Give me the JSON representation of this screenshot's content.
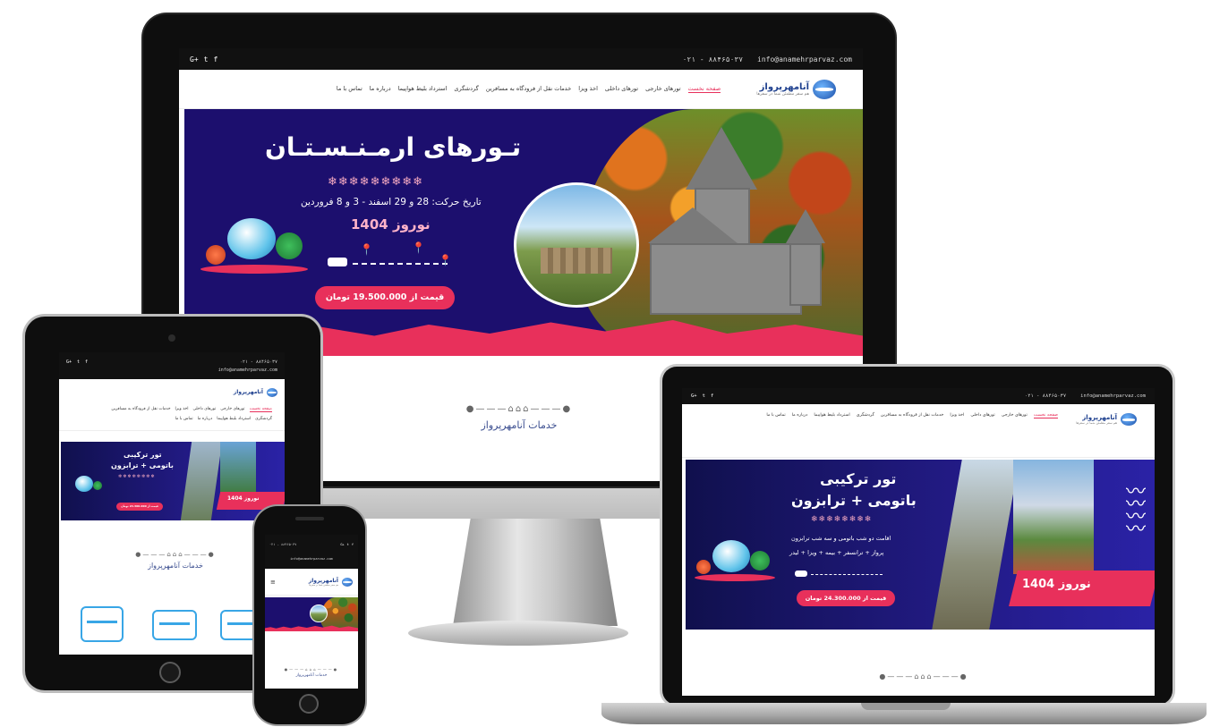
{
  "site": {
    "logo_text": "آنامهرپرواز",
    "logo_sub": "هم سفر مطمئن شما در سفرها",
    "social_icons": [
      "google-plus-icon",
      "twitter-icon",
      "facebook-icon"
    ],
    "phone": "۰۲۱ - ۸۸۴۶۵۰۳۷",
    "email": "info@anamehrparvaz.com"
  },
  "nav": {
    "items": [
      {
        "label": "صفحه نخست",
        "active": true
      },
      {
        "label": "تورهای خارجی",
        "active": false
      },
      {
        "label": "تورهای داخلی",
        "active": false
      },
      {
        "label": "اخذ ویزا",
        "active": false
      },
      {
        "label": "خدمات نقل از فرودگاه به مسافرین",
        "active": false
      },
      {
        "label": "گردشگری",
        "active": false
      },
      {
        "label": "استرداد بلیط هواپیما",
        "active": false
      },
      {
        "label": "درباره ما",
        "active": false
      },
      {
        "label": "تماس با ما",
        "active": false
      }
    ]
  },
  "imac_banner": {
    "title": "تـورهای ارمـنـسـتـان",
    "flakes": "❄❄❄❄❄❄❄❄❄",
    "date_text": "تاریخ حرکت: 28 و 29 اسفند - 3 و 8 فروردین",
    "noruz": "نوروز 1404",
    "price": "قیمت از 19.500.000 تومان"
  },
  "turkey_banner": {
    "title_line1": "تور ترکیبی",
    "title_line2": "باتومی + ترابزون",
    "flakes": "❄❄❄❄❄❄❄❄",
    "detail_line1": "اقامت دو شب باتومی و سه شب ترابزون",
    "detail_line2": "پرواز + ترانسفر + بیمه + ویزا + لیدر",
    "noruz": "نوروز 1404",
    "price": "قیمت از 24.300.000 تومان"
  },
  "services": {
    "ornament": "●———⌂⌂⌂———●",
    "title": "خدمات آنامهرپرواز"
  },
  "colors": {
    "accent": "#e8305b",
    "banner_bg": "#1c0f6e",
    "brand_blue": "#1d3f8e",
    "icon_blue": "#38a6e6"
  }
}
